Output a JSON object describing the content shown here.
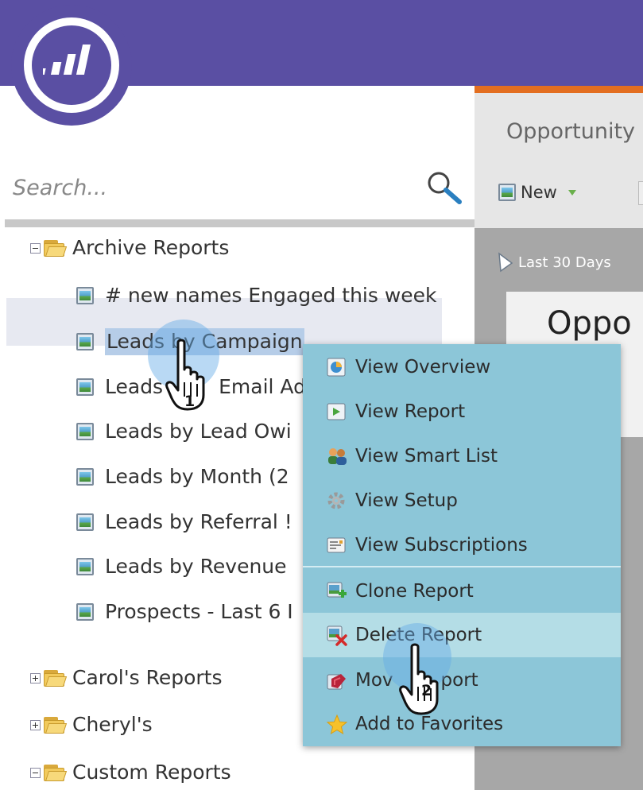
{
  "header": {
    "logo": "marketo-logo"
  },
  "right_panel": {
    "title": "Opportunity",
    "toolbar_new_label": "New",
    "filter_label": "Last 30 Days",
    "card_title": "Oppo"
  },
  "search": {
    "placeholder": "Search..."
  },
  "tree": {
    "folders": [
      {
        "label": "Archive Reports",
        "expanded": true
      },
      {
        "label": "Carol's Reports",
        "expanded": false
      },
      {
        "label": "Cheryl's",
        "expanded": false
      },
      {
        "label": "Custom Reports",
        "expanded": true
      }
    ],
    "reports": [
      {
        "label": "# new names Engaged this week"
      },
      {
        "label": "Leads by Campaign"
      },
      {
        "label": "Leads"
      },
      {
        "label": "Email Ad"
      },
      {
        "label": "Leads by Lead Owi"
      },
      {
        "label": "Leads by Month (2"
      },
      {
        "label": "Leads by Referral !"
      },
      {
        "label": "Leads by Revenue"
      },
      {
        "label": "Prospects - Last 6 I"
      }
    ]
  },
  "context_menu": {
    "items": [
      {
        "label": "View Overview",
        "icon": "overview-icon"
      },
      {
        "label": "View Report",
        "icon": "report-icon"
      },
      {
        "label": "View Smart List",
        "icon": "people-icon"
      },
      {
        "label": "View Setup",
        "icon": "gear-icon"
      },
      {
        "label": "View Subscriptions",
        "icon": "subscription-icon"
      },
      {
        "label": "Clone Report",
        "icon": "clone-icon"
      },
      {
        "label": "Delete Report",
        "icon": "delete-icon"
      },
      {
        "label": "Mov",
        "icon": "move-icon"
      },
      {
        "label": "port",
        "icon": "move-icon"
      },
      {
        "label": "Add to Favorites",
        "icon": "star-icon"
      }
    ]
  },
  "cursors": {
    "step1": "1",
    "step2": "2"
  },
  "colors": {
    "header_bg": "#5a4fa3",
    "accent_orange": "#e36e20",
    "menu_bg": "#8cc6d8",
    "menu_hover": "#b4dde6",
    "selection": "#b6cde8"
  }
}
